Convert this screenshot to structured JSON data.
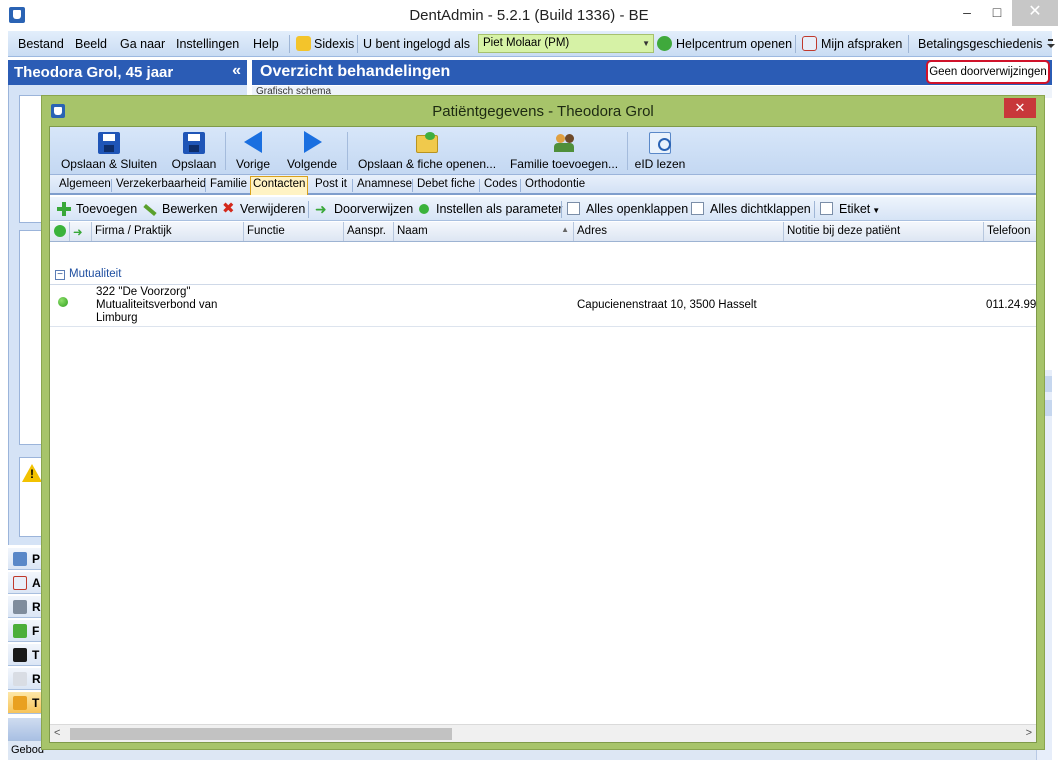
{
  "window": {
    "title": "DentAdmin - 5.2.1      (Build 1336) - BE",
    "minimize": "–",
    "maximize": "□",
    "close": "✕"
  },
  "menu": {
    "items": [
      "Bestand",
      "Beeld",
      "Ga naar",
      "Instellingen",
      "Help"
    ],
    "sidexis": "Sidexis",
    "logged_in_label": "U bent ingelogd als",
    "user": "Piet Molaar (PM)",
    "help_center": "Helpcentrum openen",
    "appointments": "Mijn afspraken",
    "payment_history": "Betalingsgeschiedenis"
  },
  "left_panel": {
    "patient": "Theodora Grol, 45 jaar",
    "collapse": "«",
    "nav": [
      "P",
      "A",
      "R",
      "F",
      "T",
      "R",
      "T"
    ],
    "status_text": "Gebod"
  },
  "main": {
    "title": "Overzicht behandelingen",
    "no_referrals_button": "Geen doorverwijzingen",
    "behind_tab": "Grafisch schema"
  },
  "dialog": {
    "title": "Patiëntgegevens - Theodora Grol",
    "close": "✕",
    "ribbon": {
      "save_close": "Opslaan & Sluiten",
      "save": "Opslaan",
      "previous": "Vorige",
      "next": "Volgende",
      "save_open_fiche": "Opslaan & fiche openen...",
      "add_family": "Familie toevoegen...",
      "read_eid": "eID lezen"
    },
    "tabs": [
      "Algemeen",
      "Verzekerbaarheid",
      "Familie",
      "Contacten",
      "Post it",
      "Anamnese",
      "Debet fiche",
      "Codes",
      "Orthodontie"
    ],
    "active_tab": "Contacten",
    "toolbar": {
      "add": "Toevoegen",
      "edit": "Bewerken",
      "delete": "Verwijderen",
      "refer": "Doorverwijzen",
      "set_param": "Instellen als parameter",
      "expand_all": "Alles openklappen",
      "collapse_all": "Alles dichtklappen",
      "label": "Etiket"
    },
    "columns": [
      "Firma / Praktijk",
      "Functie",
      "Aanspr.",
      "Naam",
      "Adres",
      "Notitie bij deze patiënt",
      "Telefoon"
    ],
    "group": {
      "toggle": "−",
      "label": "Mutualiteit"
    },
    "rows": [
      {
        "firma_line1": "322 \"De Voorzorg\"",
        "firma_line2": "Mutualiteitsverbond van",
        "firma_line3": "Limburg",
        "adres": "Capucienenstraat 10, 3500 Hasselt",
        "telefoon": "011.24.99"
      }
    ]
  }
}
